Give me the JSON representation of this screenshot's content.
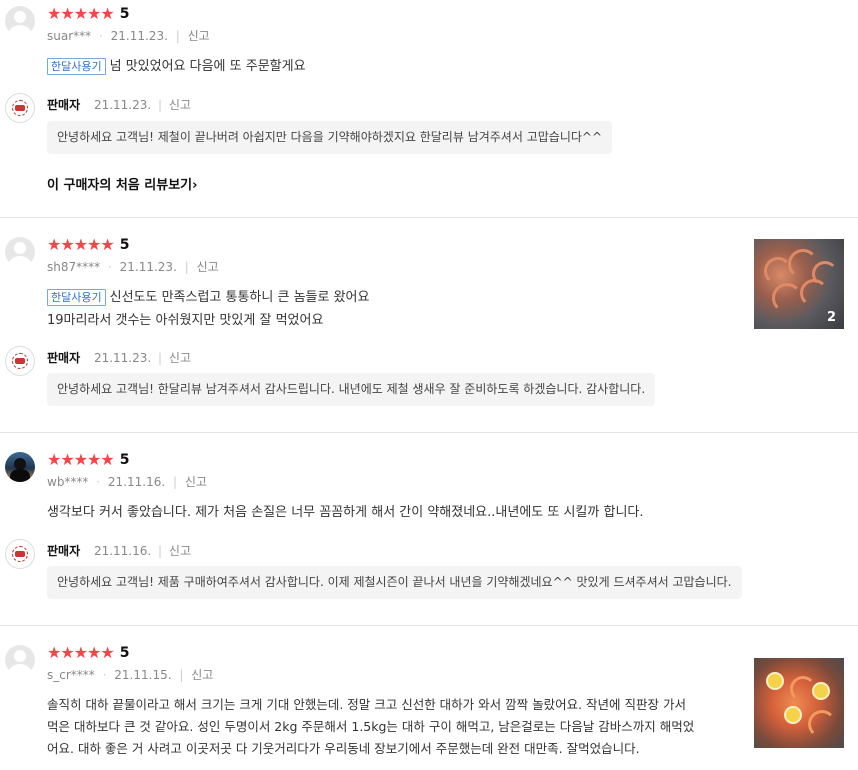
{
  "reviews": [
    {
      "score": "5",
      "user": "suar***",
      "date": "21.11.23.",
      "report": "신고",
      "tag": "한달사용기",
      "lines": [
        "넘 맛있었어요 다음에 또 주문할게요"
      ],
      "seller_name": "판매자",
      "seller_date": "21.11.23.",
      "seller_report": "신고",
      "reply": "안녕하세요 고객님! 제철이 끝나버려 아쉽지만 다음을 기약해야하겠지요 한달리뷰 남겨주셔서 고맙습니다^^",
      "first_review_link": "이 구매자의 처음 리뷰보기"
    },
    {
      "score": "5",
      "user": "sh87****",
      "date": "21.11.23.",
      "report": "신고",
      "tag": "한달사용기",
      "lines": [
        "신선도도 만족스럽고 통통하니 큰 놈들로 왔어요",
        "19마리라서 갯수는 아쉬웠지만 맛있게 잘 먹었어요"
      ],
      "photo_count": "2",
      "seller_name": "판매자",
      "seller_date": "21.11.23.",
      "seller_report": "신고",
      "reply": "안녕하세요 고객님! 한달리뷰 남겨주셔서 감사드립니다. 내년에도 제철 생새우 잘 준비하도록 하겠습니다. 감사합니다."
    },
    {
      "score": "5",
      "user": "wb****",
      "date": "21.11.16.",
      "report": "신고",
      "lines": [
        "생각보다 커서 좋았습니다. 제가 처음 손질은 너무 꼼꼼하게 해서 간이 약해졌네요..내년에도 또 시킬까 합니다."
      ],
      "seller_name": "판매자",
      "seller_date": "21.11.16.",
      "seller_report": "신고",
      "reply": "안녕하세요 고객님! 제품 구매하여주셔서 감사합니다. 이제 제철시즌이 끝나서 내년을 기약해겠네요^^ 맛있게 드셔주셔서 고맙습니다."
    },
    {
      "score": "5",
      "user": "s_cr****",
      "date": "21.11.15.",
      "report": "신고",
      "lines": [
        "솔직히 대하 끝물이라고 해서 크기는 크게 기대 안했는데. 정말 크고 신선한 대하가 와서 깜짝 놀랐어요. 작년에 직판장 가서",
        "먹은 대하보다 큰 것 같아요. 성인 두명이서 2kg 주문해서 1.5kg는 대하 구이 해먹고, 남은걸로는 다음날 감바스까지 해먹었",
        "어요. 대하 좋은 거 사려고 이곳저곳 다 기웃거리다가 우리동네 장보기에서 주문했는데 완전 대만족. 잘먹었습니다."
      ]
    }
  ],
  "colors": {
    "star": "#f4454a",
    "tag_border": "#7ba7d9",
    "tag_text": "#2f72c6",
    "reply_bg": "#f4f4f4"
  },
  "icons": {
    "star": "star-icon",
    "chevron": "chevron-right-icon",
    "avatar": "user-avatar-icon"
  }
}
